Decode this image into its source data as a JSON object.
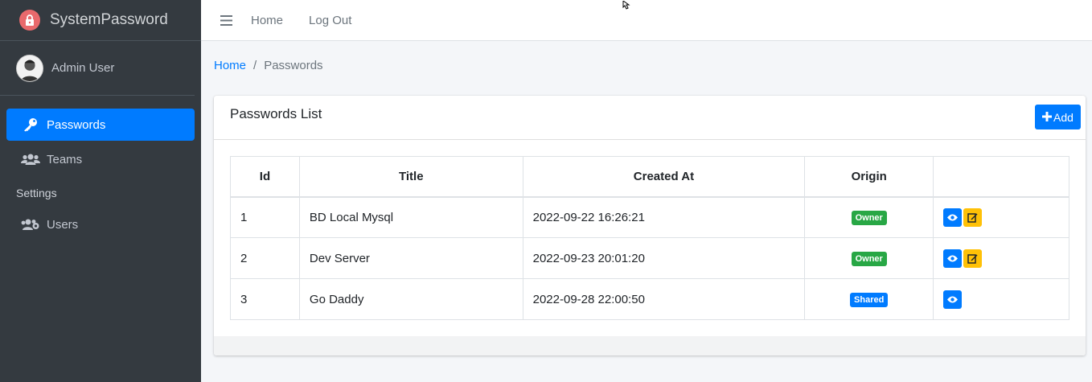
{
  "brand": {
    "name": "SystemPassword",
    "logo_icon": "lock-icon",
    "logo_color": "#e9696c"
  },
  "user": {
    "name": "Admin User"
  },
  "sidebar": {
    "items": [
      {
        "label": "Passwords",
        "icon": "key-icon",
        "active": true
      },
      {
        "label": "Teams",
        "icon": "users-icon",
        "active": false
      }
    ],
    "header": "Settings",
    "settings_items": [
      {
        "label": "Users",
        "icon": "users-cog-icon",
        "active": false
      }
    ]
  },
  "navbar": {
    "home": "Home",
    "logout": "Log Out"
  },
  "breadcrumb": {
    "home": "Home",
    "separator": "/",
    "current": "Passwords"
  },
  "card": {
    "title": "Passwords List",
    "add_label": "Add"
  },
  "table": {
    "headers": [
      "Id",
      "Title",
      "Created At",
      "Origin",
      ""
    ],
    "rows": [
      {
        "id": "1",
        "title": "BD Local Mysql",
        "created_at": "2022-09-22 16:26:21",
        "origin": "Owner"
      },
      {
        "id": "2",
        "title": "Dev Server",
        "created_at": "2022-09-23 20:01:20",
        "origin": "Owner"
      },
      {
        "id": "3",
        "title": "Go Daddy",
        "created_at": "2022-09-28 22:00:50",
        "origin": "Shared"
      }
    ]
  },
  "colors": {
    "primary": "#007bff",
    "success": "#28a745",
    "warning": "#ffc107",
    "sidebar_bg": "#343a40"
  }
}
